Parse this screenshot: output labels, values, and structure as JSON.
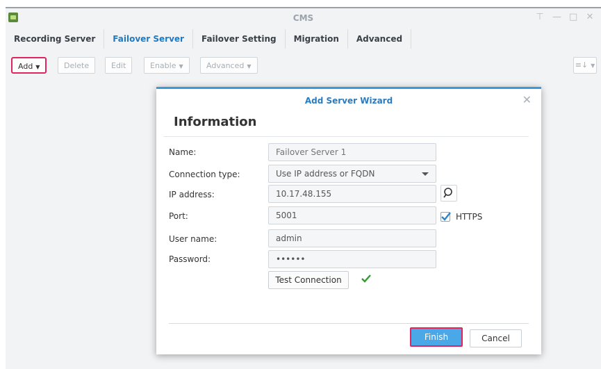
{
  "window": {
    "title": "CMS"
  },
  "tabs": [
    {
      "label": "Recording Server"
    },
    {
      "label": "Failover Server",
      "active": true
    },
    {
      "label": "Failover Setting"
    },
    {
      "label": "Migration"
    },
    {
      "label": "Advanced"
    }
  ],
  "toolbar": {
    "add": "Add",
    "delete": "Delete",
    "edit": "Edit",
    "enable": "Enable",
    "advanced": "Advanced",
    "sort_icon": "≡↓"
  },
  "dialog": {
    "title": "Add Server Wizard",
    "section": "Information",
    "fields": {
      "name_label": "Name:",
      "name_placeholder": "Failover Server 1",
      "connection_label": "Connection type:",
      "connection_value": "Use IP address or FQDN",
      "ip_label": "IP address:",
      "ip_value": "10.17.48.155",
      "port_label": "Port:",
      "port_value": "5001",
      "https_label": "HTTPS",
      "https_checked": true,
      "user_label": "User name:",
      "user_value": "admin",
      "password_label": "Password:",
      "password_value": "••••••"
    },
    "test_button": "Test Connection",
    "finish_button": "Finish",
    "cancel_button": "Cancel"
  },
  "colors": {
    "accent": "#2a7cc0",
    "highlight": "#e0245e",
    "success": "#2e9b2e",
    "primary_button": "#4aa8e8"
  },
  "icons": {
    "app": "cms-app-icon",
    "search": "search-icon",
    "check": "check-icon",
    "close": "close-icon"
  }
}
